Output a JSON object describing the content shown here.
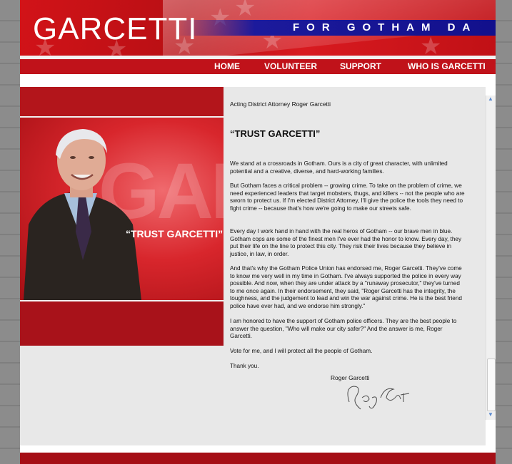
{
  "banner": {
    "logo": "GARCETTI",
    "tagline": "FOR GOTHAM DA"
  },
  "nav": {
    "items": [
      {
        "label": "HOME"
      },
      {
        "label": "VOLUNTEER"
      },
      {
        "label": "SUPPORT"
      },
      {
        "label": "WHO IS GARCETTI"
      }
    ]
  },
  "photo": {
    "background_letters": "GARC",
    "quote": "“TRUST GARCETTI”"
  },
  "content": {
    "intro": "Acting District Attorney Roger Garcetti",
    "heading": "“TRUST GARCETTI”",
    "paragraphs": [
      "We stand at a crossroads in Gotham. Ours is a city of great character, with unlimited potential and a creative, diverse, and hard-working families.",
      "But Gotham faces a critical problem -- growing crime. To take on the problem of crime, we need experienced leaders that target mobsters, thugs, and killers -- not the people who are sworn to protect us. If I'm elected District Attorney, I'll give the police the tools they need to fight crime -- because that's how we're going to make our streets safe.",
      "Every day I work hand in hand with the real heros of Gotham -- our brave men in blue. Gotham cops are some of the finest men I've ever had the honor to know. Every day, they put their life on the line to protect this city. They risk their lives because they believe in justice, in law, in order.",
      "And that's why the Gotham Police Union has endorsed me, Roger Garcetti. They've come to know me very well in my time in Gotham. I've always supported the police in every way possible. And now, when they are under attack by a \"runaway prosecutor,\" they've turned to me once again. In their endorsement, they said, \"Roger Garcetti has the integrity, the toughness, and the judgement to lead and win the war against crime. He is the best friend police have ever had, and we endorse him strongly.\"",
      "I am honored to have the support of Gotham police officers. They are the best people to answer the question, \"Who will make our city safer?\" And the answer is me, Roger Garcetti.",
      "Vote for me, and I will protect all the people of Gotham.",
      "Thank you."
    ],
    "signature_name": "Roger Garcetti"
  },
  "colors": {
    "brand_red": "#c0121a",
    "tagline_blue": "#12108c",
    "content_bg": "#e8e8e8"
  },
  "icons": {
    "scroll_up": "triangle-up",
    "scroll_down": "triangle-down"
  }
}
